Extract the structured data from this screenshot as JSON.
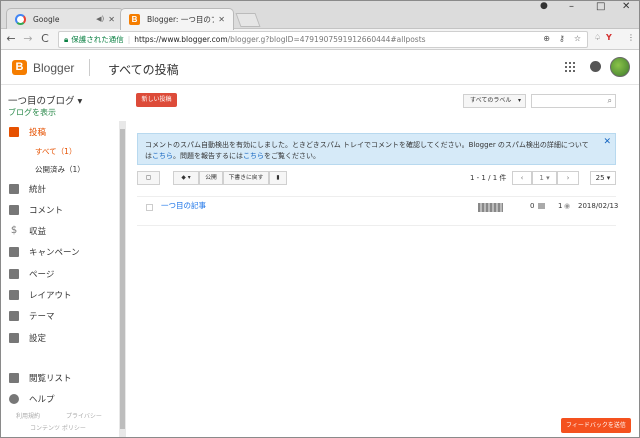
{
  "browser": {
    "tabs": [
      {
        "title": "Google",
        "active": false
      },
      {
        "title": "Blogger: 一つ目のブログ -",
        "active": true
      }
    ],
    "secure_label": "保護された通信",
    "url_main": "https://www.blogger.com",
    "url_rest": "/blogger.g?blogID=4791907591912660444#allposts",
    "window_controls": [
      "–",
      "□",
      "✕"
    ],
    "nav": {
      "back": "←",
      "forward": "→",
      "reload": "C"
    }
  },
  "header": {
    "brand": "Blogger",
    "page_title": "すべての投稿"
  },
  "sidebar": {
    "blog_name": "一つ目のブログ ▾",
    "view_blog": "ブログを表示",
    "items": [
      {
        "label": "投稿",
        "icon": "posts-icon"
      },
      {
        "label": "統計",
        "icon": "stats-icon"
      },
      {
        "label": "コメント",
        "icon": "comment-icon"
      },
      {
        "label": "収益",
        "icon": "dollar-icon"
      },
      {
        "label": "キャンペーン",
        "icon": "campaign-icon"
      },
      {
        "label": "ページ",
        "icon": "pages-icon"
      },
      {
        "label": "レイアウト",
        "icon": "layout-icon"
      },
      {
        "label": "テーマ",
        "icon": "theme-icon"
      },
      {
        "label": "設定",
        "icon": "gear-icon"
      },
      {
        "label": "閲覧リスト",
        "icon": "bookmark-icon"
      },
      {
        "label": "ヘルプ",
        "icon": "help-icon"
      }
    ],
    "sub_items": [
      {
        "label": "すべて（1）"
      },
      {
        "label": "公開済み（1）"
      }
    ],
    "footer": {
      "terms": "利用規約",
      "privacy": "プライバシー",
      "content_policy": "コンテンツ ポリシー"
    }
  },
  "toolbar": {
    "new_post": "新しい投稿",
    "label_filter": "すべてのラベル",
    "publish": "公開",
    "revert_draft": "下書きに戻す",
    "pagination": "1 - 1 / 1 件",
    "page_select": "1",
    "per_page": "25"
  },
  "notice": {
    "text1": "コメントのスパム自動検出を有効にしました。ときどきスパム トレイでコメントを確認してください。Blogger のスパム検出の詳細については",
    "link1": "こちら",
    "text2": "。問題を報告するには",
    "link2": "こちら",
    "text3": "をご覧ください。"
  },
  "posts": [
    {
      "title": "一つ目の記事",
      "comments": "0",
      "views": "1",
      "date": "2018/02/13"
    }
  ],
  "feedback": "フィードバックを送信",
  "colors": {
    "accent": "#e65100",
    "brand": "#f57d00",
    "link": "#1a73e8",
    "new_post": "#dd4b39"
  }
}
